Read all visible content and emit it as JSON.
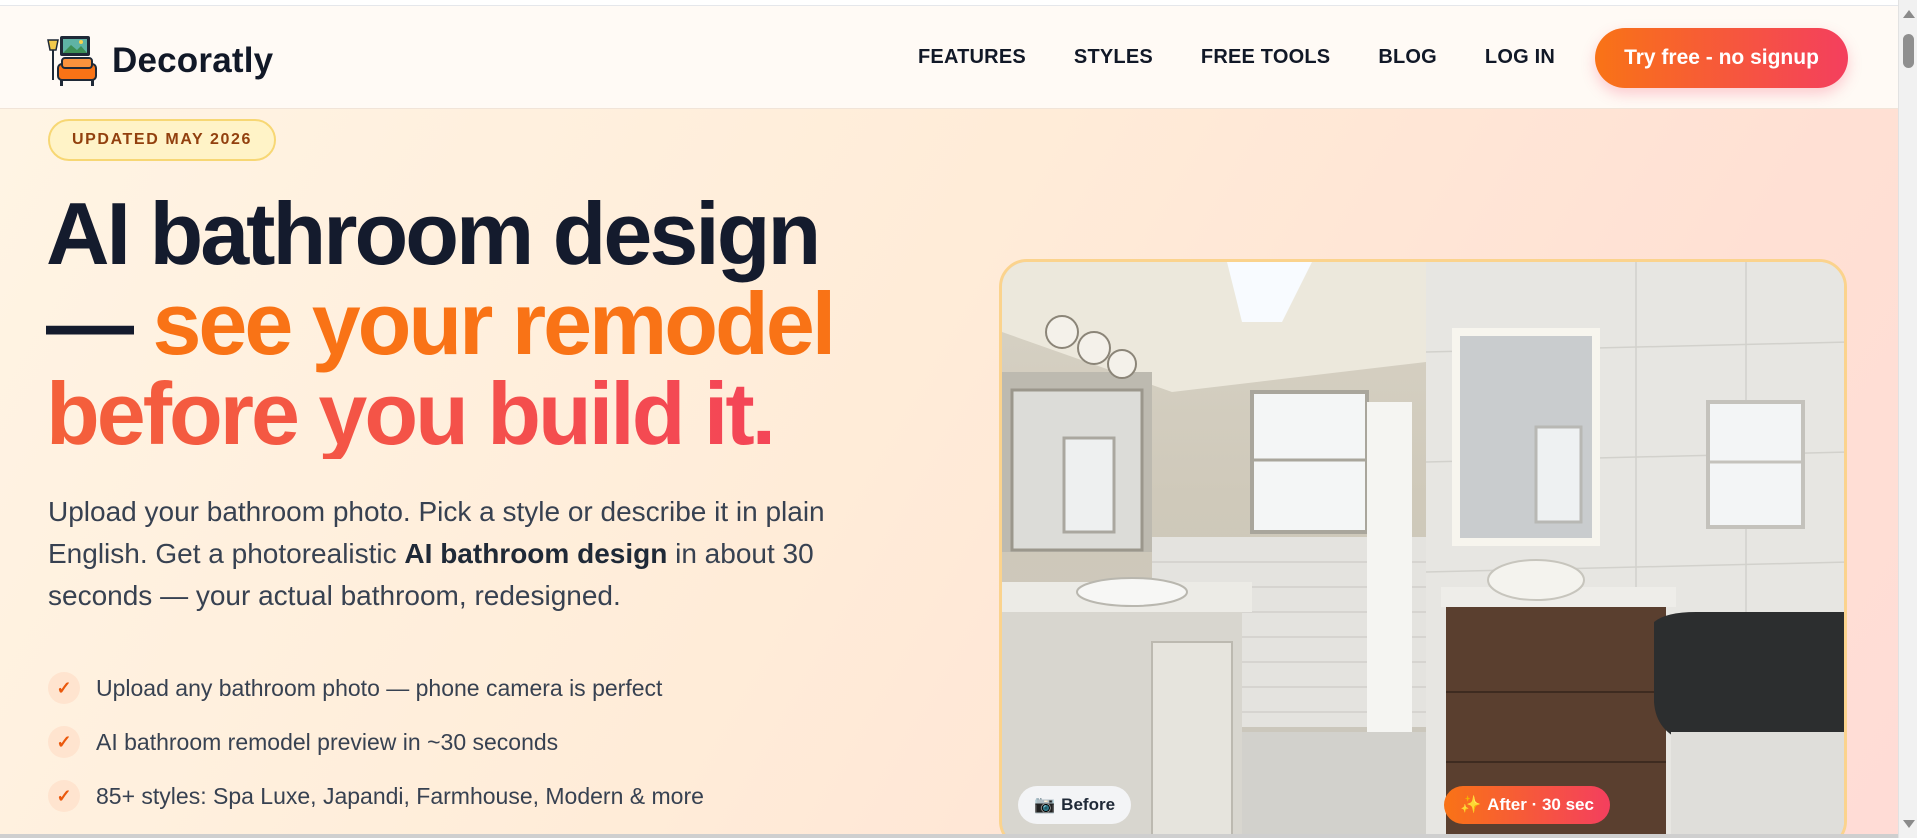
{
  "brand": {
    "name": "Decoratly"
  },
  "nav": {
    "items": [
      "FEATURES",
      "STYLES",
      "FREE TOOLS",
      "BLOG",
      "LOG IN"
    ],
    "cta": "Try free - no signup"
  },
  "hero": {
    "badge": "UPDATED MAY 2026",
    "headline": {
      "line1": "AI bathroom design",
      "dash": "— ",
      "line2_highlight": "see your remodel",
      "line3": "before you build it."
    },
    "lead": {
      "part1": "Upload your bathroom photo. Pick a style or describe it in plain English. Get a photorealistic ",
      "bold": "AI bathroom design",
      "part2": " in about 30 seconds — your actual bathroom, redesigned."
    },
    "checks": [
      "Upload any bathroom photo — phone camera is perfect",
      "AI bathroom remodel preview in ~30 seconds",
      "85+ styles: Spa Luxe, Japandi, Farmhouse, Modern & more"
    ],
    "check_symbol": "✓"
  },
  "compare": {
    "before_label": "Before",
    "after_label": "After · 30 sec",
    "before_icon": "📷",
    "after_icon": "✨"
  },
  "colors": {
    "accent_orange": "#f97316",
    "accent_pink": "#f43f5e",
    "ink": "#141b2d"
  }
}
